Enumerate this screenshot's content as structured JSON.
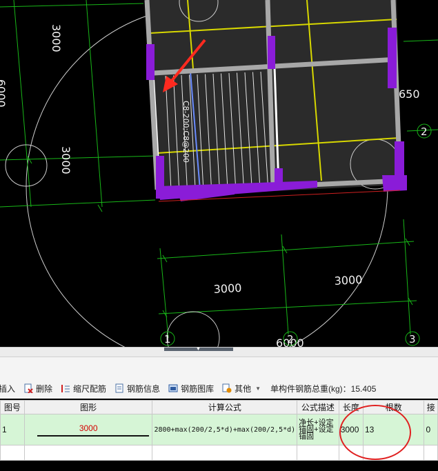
{
  "drawing": {
    "dims": {
      "left_vertical": "3000",
      "left_edge": "6000",
      "mid_vertical": "3000",
      "bottom_left": "3000",
      "bottom_right": "3000",
      "bottom_total": "6000",
      "right_side": "650"
    },
    "axis_labels": {
      "a1": "1",
      "a2": "2",
      "a3": "3",
      "r2": "2"
    },
    "rebar_label": "C8-200;C8@200",
    "colors": {
      "slab": "#2b2b2b",
      "beam": "#b7b7b7",
      "column": "#8a1cd8",
      "grid": "#18b818",
      "rebar_line": "#d8d800",
      "arrow": "#ff2a1f"
    }
  },
  "toolbar": {
    "insert": "插入",
    "delete": "删除",
    "scale": "缩尺配筋",
    "info": "钢筋信息",
    "library": "钢筋图库",
    "other": "其他",
    "total": "单构件钢筋总重(kg)：15.405"
  },
  "table": {
    "headers": [
      "图号",
      "图形",
      "计算公式",
      "公式描述",
      "长度",
      "根数",
      "接"
    ],
    "rows": [
      {
        "no": "1",
        "shape_value": "3000",
        "formula": "2800+max(200/2,5*d)+max(200/2,5*d)",
        "desc": "净长+设定锚固+设定锚固",
        "length": "3000",
        "count": "13",
        "lap": "0"
      }
    ]
  }
}
